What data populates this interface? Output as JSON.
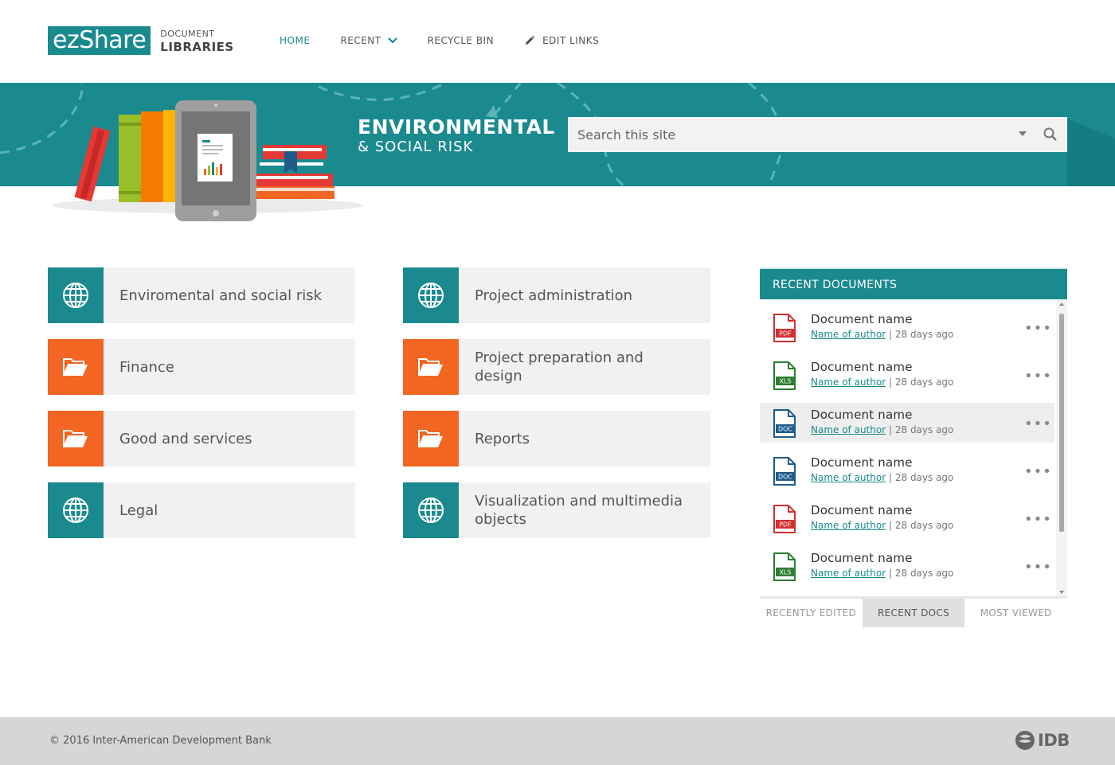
{
  "brand": {
    "logo": "ezShare",
    "line1": "DOCUMENT",
    "line2": "LIBRARIES",
    "teal": "#1a8a8f",
    "orange": "#f26522"
  },
  "nav": {
    "home": "HOME",
    "recent": "RECENT",
    "recycle": "RECYCLE BIN",
    "edit": "EDIT LINKS"
  },
  "banner": {
    "title": "ENVIRONMENTAL",
    "subtitle": "& SOCIAL RISK",
    "search_placeholder": "Search this site"
  },
  "tiles": [
    {
      "label": "Enviromental and social risk",
      "icon": "globe-icon",
      "color": "teal"
    },
    {
      "label": "Project administration",
      "icon": "globe-icon",
      "color": "teal"
    },
    {
      "label": "Finance",
      "icon": "folder-icon",
      "color": "orange"
    },
    {
      "label": "Project preparation and design",
      "icon": "folder-icon",
      "color": "orange"
    },
    {
      "label": "Good and services",
      "icon": "folder-icon",
      "color": "orange"
    },
    {
      "label": "Reports",
      "icon": "folder-icon",
      "color": "orange"
    },
    {
      "label": "Legal",
      "icon": "globe-icon",
      "color": "teal"
    },
    {
      "label": "Visualization and multimedia objects",
      "icon": "globe-icon",
      "color": "teal"
    }
  ],
  "recent": {
    "heading": "RECENT DOCUMENTS",
    "items": [
      {
        "type": "PDF",
        "name": "Document name",
        "author": "Name of author",
        "sep": "|",
        "time": "28 days ago"
      },
      {
        "type": "XLS",
        "name": "Document name",
        "author": "Name of author",
        "sep": "|",
        "time": "28 days ago"
      },
      {
        "type": "DOC",
        "name": "Document name",
        "author": "Name of author",
        "sep": "|",
        "time": "28 days ago"
      },
      {
        "type": "DOC",
        "name": "Document name",
        "author": "Name of author",
        "sep": "|",
        "time": "28 days ago"
      },
      {
        "type": "PDF",
        "name": "Document name",
        "author": "Name of author",
        "sep": "|",
        "time": "28 days ago"
      },
      {
        "type": "XLS",
        "name": "Document name",
        "author": "Name of author",
        "sep": "|",
        "time": "28 days ago"
      }
    ],
    "more": "•••",
    "tabs": [
      "RECENTLY EDITED",
      "RECENT DOCS",
      "MOST VIEWED"
    ]
  },
  "footer": {
    "copyright": "© 2016 Inter-American Development Bank",
    "logo": "IDB"
  }
}
